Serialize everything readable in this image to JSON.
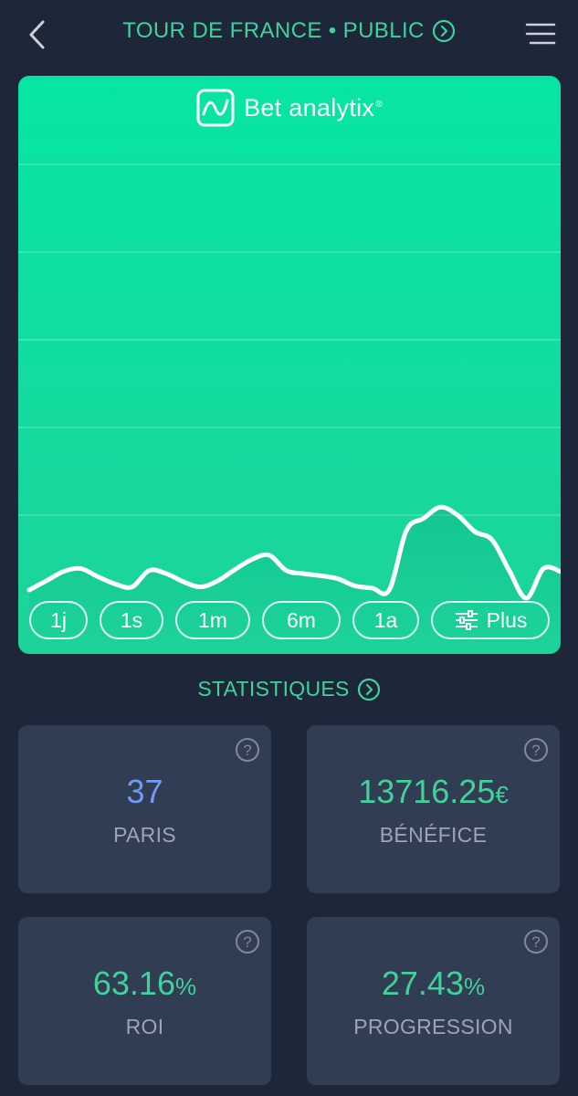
{
  "header": {
    "title": "TOUR DE FRANCE • PUBLIC",
    "back_icon": "chevron-left-icon",
    "title_icon": "circle-chevron-right-icon",
    "menu_icon": "hamburger-menu-icon"
  },
  "brand": {
    "name": "Bet analytix",
    "registered": "®"
  },
  "colors": {
    "background": "#1e2639",
    "accent": "#3fd39a",
    "chart_bg": "#06e5a4",
    "card_bg": "#313d52",
    "paris_value": "#6f9cf5",
    "muted_text": "#9aa5b6"
  },
  "chart_data": {
    "type": "line",
    "title": "",
    "xlabel": "",
    "ylabel": "",
    "grid": true,
    "gridlines": 5,
    "series": [
      {
        "values": [
          0.0,
          0.9,
          1.8,
          2.1,
          1.3,
          0.6,
          0.3,
          1.9,
          1.6,
          0.8,
          0.3,
          0.9,
          2.0,
          3.0,
          3.4,
          1.9,
          1.6,
          1.4,
          1.1,
          0.4,
          0.2,
          0.0,
          5.8,
          7.0,
          8.1,
          7.3,
          5.7,
          4.9,
          1.9,
          -0.8,
          2.1,
          1.8
        ]
      }
    ]
  },
  "periods": [
    {
      "label": "1j"
    },
    {
      "label": "1s"
    },
    {
      "label": "1m"
    },
    {
      "label": "6m"
    },
    {
      "label": "1a"
    },
    {
      "label": "Plus",
      "icon": "sliders-icon"
    }
  ],
  "stats_section": {
    "title": "STATISTIQUES",
    "icon": "circle-chevron-right-icon"
  },
  "stats": [
    {
      "value": "37",
      "unit": "",
      "label": "PARIS",
      "color": "#6f9cf5"
    },
    {
      "value": "13716.25",
      "unit": "€",
      "label": "BÉNÉFICE",
      "color": "#3fd39a"
    },
    {
      "value": "63.16",
      "unit": "%",
      "label": "ROI",
      "color": "#3fd39a"
    },
    {
      "value": "27.43",
      "unit": "%",
      "label": "PROGRESSION",
      "color": "#3fd39a"
    }
  ]
}
